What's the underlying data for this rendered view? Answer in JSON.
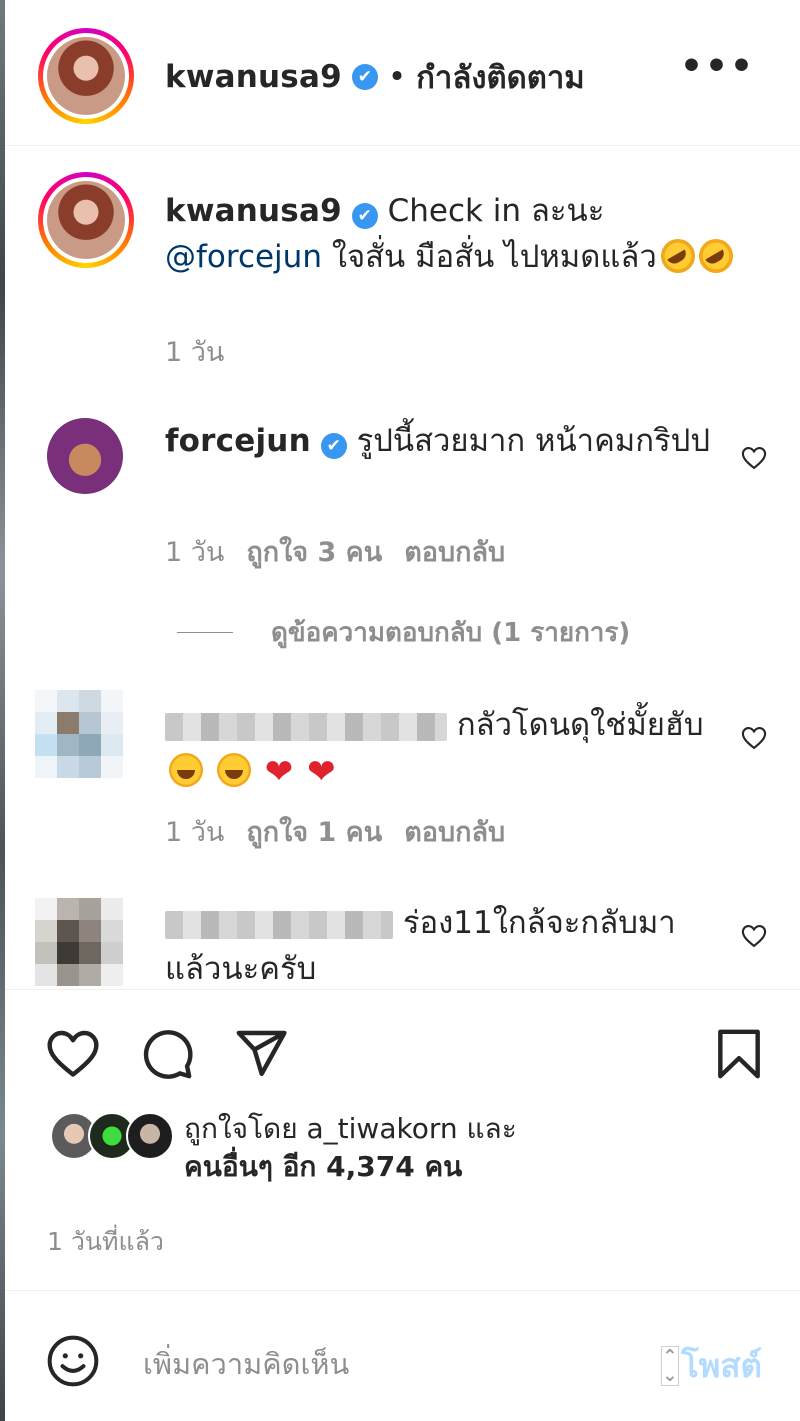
{
  "header": {
    "username": "kwanusa9",
    "verified_glyph": "✔",
    "separator": "•",
    "following_label": "กำลังติดตาม",
    "more_label": "•••"
  },
  "caption": {
    "username": "kwanusa9",
    "text_part1": "Check in ละนะ",
    "mention": "@forcejun",
    "text_part2": " ใจสั่น มือสั่น ไปหมดแล้ว",
    "time": "1 วัน"
  },
  "comments": [
    {
      "username": "forcejun",
      "text": "รูปนี้สวยมาก หน้าคมกริปป",
      "time": "1 วัน",
      "likes": "ถูกใจ 3 คน",
      "reply_label": "ตอบกลับ",
      "view_replies": "ดูข้อความตอบกลับ (1 รายการ)"
    },
    {
      "username": "",
      "text": "กลัวโดนดุใช่มั้ยฮับ",
      "time": "1 วัน",
      "likes": "ถูกใจ 1 คน",
      "reply_label": "ตอบกลับ"
    },
    {
      "username": "",
      "text": "ร่อง11ใกล้จะกลับมาแล้วนะครับ"
    }
  ],
  "likes": {
    "line1": "ถูกใจโดย a_tiwakorn และ",
    "line2": "คนอื่นๆ อีก 4,374 คน"
  },
  "post_time": "1 วันที่แล้ว",
  "comment_input": {
    "placeholder": "เพิ่มความคิดเห็น",
    "post_label": "โพสต์"
  },
  "icons": {
    "like": "heart-icon",
    "comment": "comment-bubble-icon",
    "share": "paper-plane-icon",
    "save": "bookmark-icon",
    "emoji": "smiley-icon",
    "more": "more-options-icon"
  },
  "colors": {
    "verified": "#3897f0",
    "mention": "#00376b",
    "muted": "#8e8e8e",
    "post_button": "#b3dbff"
  }
}
